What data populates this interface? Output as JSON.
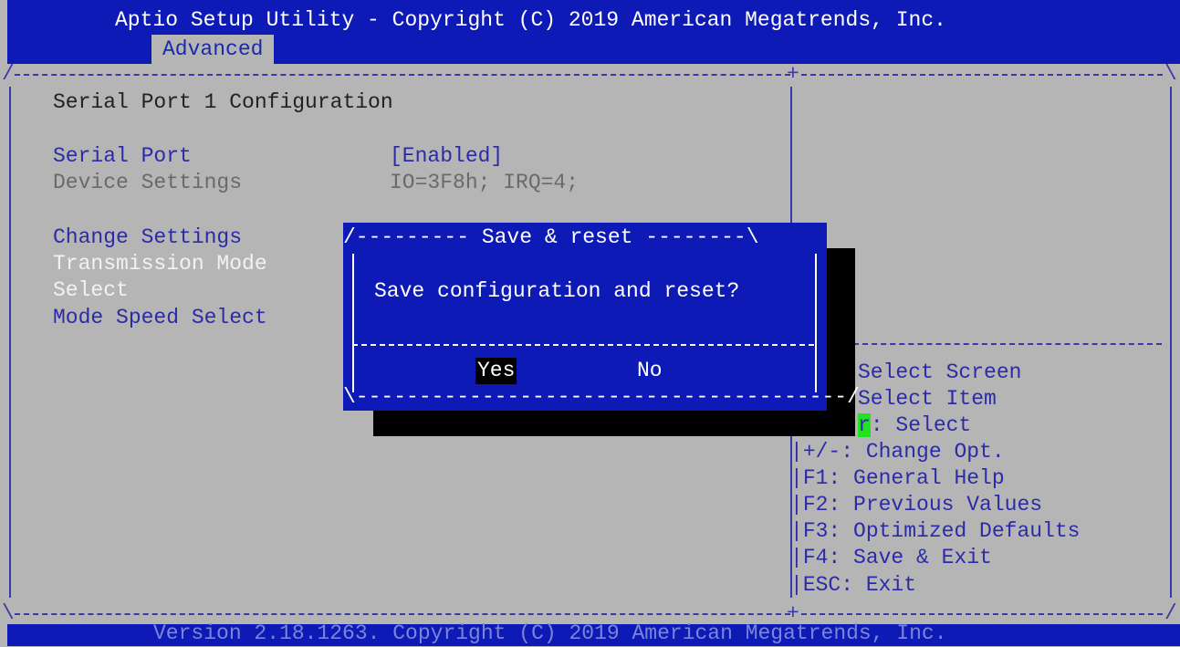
{
  "header": {
    "title": "Aptio Setup Utility - Copyright (C) 2019 American Megatrends, Inc.",
    "active_tab": "Advanced"
  },
  "main": {
    "section_title": "Serial Port 1 Configuration",
    "items": [
      {
        "label": "Serial Port",
        "value": "[Enabled]"
      },
      {
        "label": "Device Settings",
        "value": "IO=3F8h; IRQ=4;"
      },
      {
        "label": "Change Settings"
      },
      {
        "label": "Transmission Mode"
      },
      {
        "label": "Select"
      },
      {
        "label": "Mode Speed Select"
      }
    ]
  },
  "dialog": {
    "title": "Save & reset",
    "message": "Save configuration and reset?",
    "yes_label": "Yes",
    "no_label": "No"
  },
  "help": {
    "select_screen": "Select Screen",
    "select_item": "Select Item",
    "enter_key": "r",
    "enter_text": ": Select",
    "change_opt": "+/-: Change Opt.",
    "f1": "F1: General Help",
    "f2": "F2: Previous Values",
    "f3": "F3: Optimized Defaults",
    "f4": "F4: Save & Exit",
    "esc": "ESC: Exit"
  },
  "footer": {
    "version": "Version 2.18.1263. Copyright (C) 2019 American Megatrends, Inc."
  },
  "colors": {
    "header_bg": "#0d1ab5",
    "screen_bg": "#b5b5b5",
    "highlight_green": "#22e022"
  }
}
